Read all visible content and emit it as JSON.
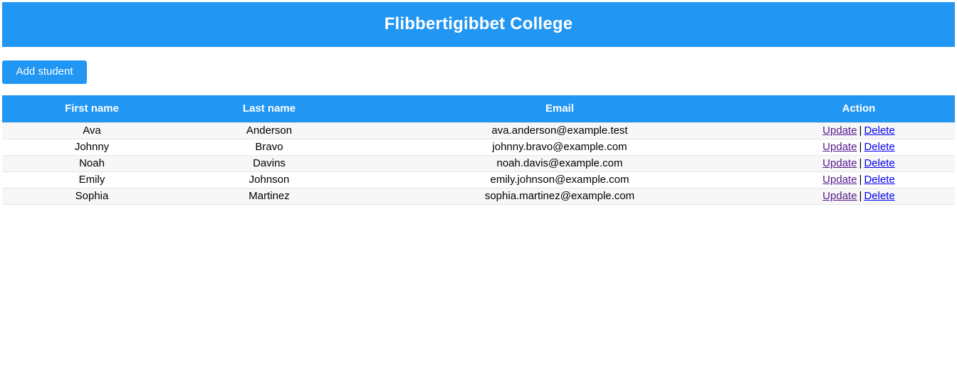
{
  "banner": {
    "title": "Flibbertigibbet College",
    "bg_color": "#2196f3",
    "text_color": "#ffffff"
  },
  "toolbar": {
    "add_student_label": "Add student"
  },
  "table": {
    "columns": [
      "First name",
      "Last name",
      "Email",
      "Action"
    ],
    "action_separator": "|",
    "link_colors": {
      "update": "#551a8b",
      "delete": "#0000ee"
    },
    "rows": [
      {
        "first_name": "Ava",
        "last_name": "Anderson",
        "email": "ava.anderson@example.test",
        "update_label": "Update",
        "delete_label": "Delete"
      },
      {
        "first_name": "Johnny",
        "last_name": "Bravo",
        "email": "johnny.bravo@example.com",
        "update_label": "Update",
        "delete_label": "Delete"
      },
      {
        "first_name": "Noah",
        "last_name": "Davins",
        "email": "noah.davis@example.com",
        "update_label": "Update",
        "delete_label": "Delete"
      },
      {
        "first_name": "Emily",
        "last_name": "Johnson",
        "email": "emily.johnson@example.com",
        "update_label": "Update",
        "delete_label": "Delete"
      },
      {
        "first_name": "Sophia",
        "last_name": "Martinez",
        "email": "sophia.martinez@example.com",
        "update_label": "Update",
        "delete_label": "Delete"
      }
    ]
  }
}
